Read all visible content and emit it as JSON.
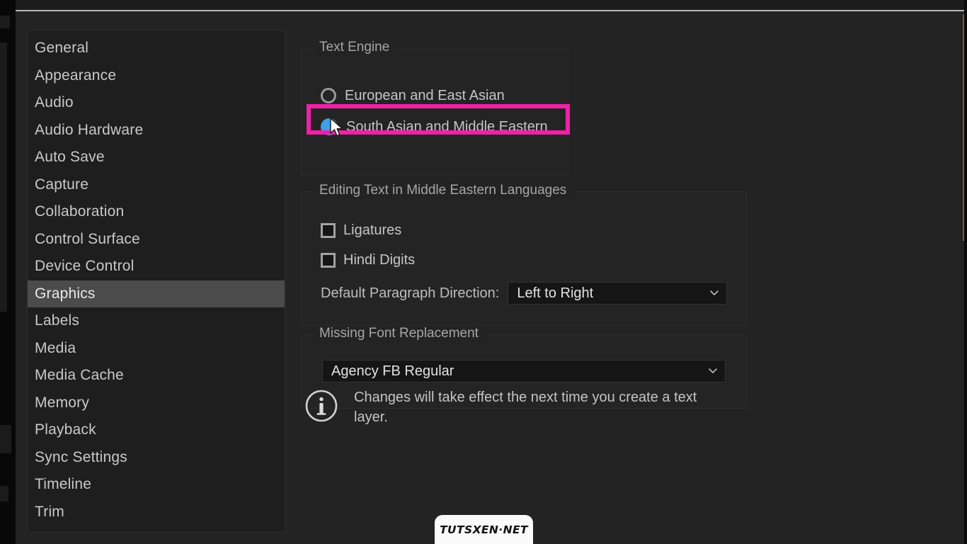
{
  "window": {
    "accent_highlight": "#f020a8",
    "selected_radio_color": "#3fa0e8",
    "panel_background": "#232323"
  },
  "sidebar": {
    "name": "preferences-category-list",
    "selected": "Graphics",
    "items": [
      {
        "label": "General"
      },
      {
        "label": "Appearance"
      },
      {
        "label": "Audio"
      },
      {
        "label": "Audio Hardware"
      },
      {
        "label": "Auto Save"
      },
      {
        "label": "Capture"
      },
      {
        "label": "Collaboration"
      },
      {
        "label": "Control Surface"
      },
      {
        "label": "Device Control"
      },
      {
        "label": "Graphics"
      },
      {
        "label": "Labels"
      },
      {
        "label": "Media"
      },
      {
        "label": "Media Cache"
      },
      {
        "label": "Memory"
      },
      {
        "label": "Playback"
      },
      {
        "label": "Sync Settings"
      },
      {
        "label": "Timeline"
      },
      {
        "label": "Trim"
      }
    ]
  },
  "text_engine": {
    "title": "Text Engine",
    "options": [
      {
        "label": "European and East Asian",
        "selected": false
      },
      {
        "label": "South Asian and Middle Eastern",
        "selected": true
      }
    ]
  },
  "editing_text": {
    "title": "Editing Text in Middle Eastern Languages",
    "ligatures_label": "Ligatures",
    "ligatures_checked": false,
    "hindi_digits_label": "Hindi Digits",
    "hindi_digits_checked": false,
    "paragraph_direction_label": "Default Paragraph Direction:",
    "paragraph_direction_value": "Left to Right"
  },
  "missing_font": {
    "title": "Missing Font Replacement",
    "value": "Agency FB Regular"
  },
  "info": {
    "icon": "info-circle-icon",
    "message": "Changes will take effect the next time you create a text layer."
  },
  "watermark": {
    "text": "TUTSXEN·NET"
  }
}
